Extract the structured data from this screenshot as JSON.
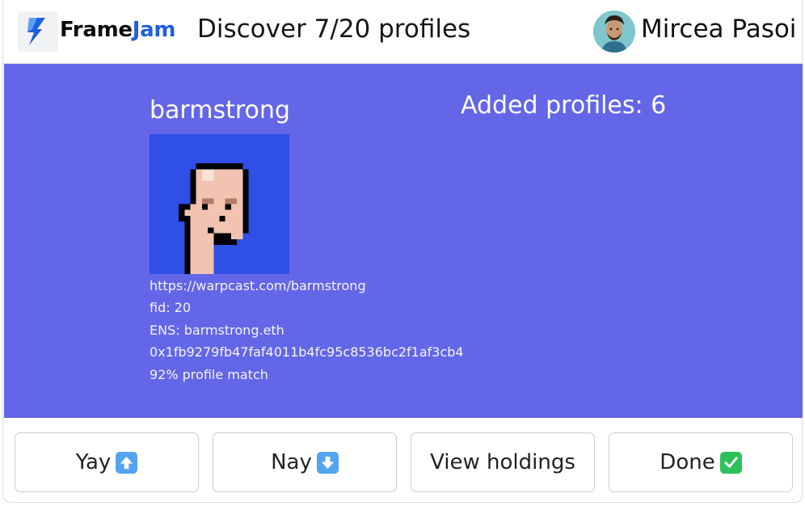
{
  "header": {
    "brand_part1": "Frame",
    "brand_part2": "Jam",
    "subtitle": "Discover 7/20 profiles",
    "user_name": "Mircea Pasoi"
  },
  "profile": {
    "username": "barmstrong",
    "url": "https://warpcast.com/barmstrong",
    "fid": "fid: 20",
    "ens": "ENS: barmstrong.eth",
    "address": "0x1fb9279fb47faf4011b4fc95c8536bc2f1af3cb4",
    "match": "92% profile match"
  },
  "added_profiles": "Added profiles: 6",
  "buttons": [
    {
      "label": "Yay",
      "icon": "up-arrow-icon"
    },
    {
      "label": "Nay",
      "icon": "down-arrow-icon"
    },
    {
      "label": "View holdings",
      "icon": ""
    },
    {
      "label": "Done",
      "icon": "check-mark-icon"
    }
  ],
  "colors": {
    "panel_bg": "#6466e8",
    "brand_accent": "#1f5fe0",
    "pfp_bg": "#2f4fe6"
  }
}
